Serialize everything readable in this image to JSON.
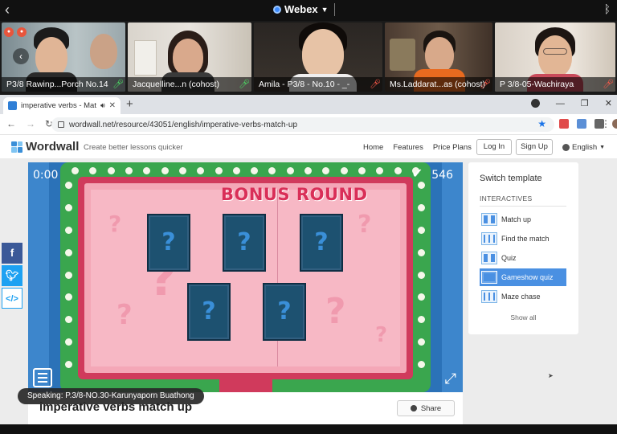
{
  "webex": {
    "title": "Webex",
    "participants": [
      {
        "label": "P3/8 Rawinp...Porch No.14",
        "mic": "on"
      },
      {
        "label": "Jacquelline...n (cohost)",
        "mic": "on"
      },
      {
        "label": "Amila - P3/8 - No.10 - _-",
        "mic": "off"
      },
      {
        "label": "Ms.Laddarat...as (cohost)",
        "mic": "off"
      },
      {
        "label": "P 3/8-05-Wachiraya",
        "mic": "off"
      }
    ],
    "speaking": "Speaking: P.3/8-NO.30-Karunyaporn Buathong"
  },
  "browser": {
    "tab_title": "imperative verbs - Match up",
    "url": "wordwall.net/resource/43051/english/imperative-verbs-match-up"
  },
  "wordwall": {
    "brand": "Wordwall",
    "tagline": "Create better lessons quicker",
    "nav": [
      "Home",
      "Features",
      "Price Plans"
    ],
    "login": "Log In",
    "signup": "Sign Up",
    "language": "English"
  },
  "game": {
    "timer": "0:00",
    "score": "546",
    "banner": "BONUS ROUND",
    "cards": [
      "?",
      "?",
      "?",
      "?",
      "?"
    ]
  },
  "templates": {
    "title": "Switch template",
    "section": "INTERACTIVES",
    "items": [
      "Match up",
      "Find the match",
      "Quiz",
      "Gameshow quiz",
      "Maze chase"
    ],
    "active": "Gameshow quiz",
    "show_all": "Show all"
  },
  "activity": {
    "title": "imperative verbs match up",
    "share": "Share"
  },
  "colors": {
    "accent": "#4a90e2",
    "game_bg": "#2b72b8",
    "frame_green": "#3aa64e",
    "frame_red": "#d03a5c",
    "card": "#1d5170"
  }
}
